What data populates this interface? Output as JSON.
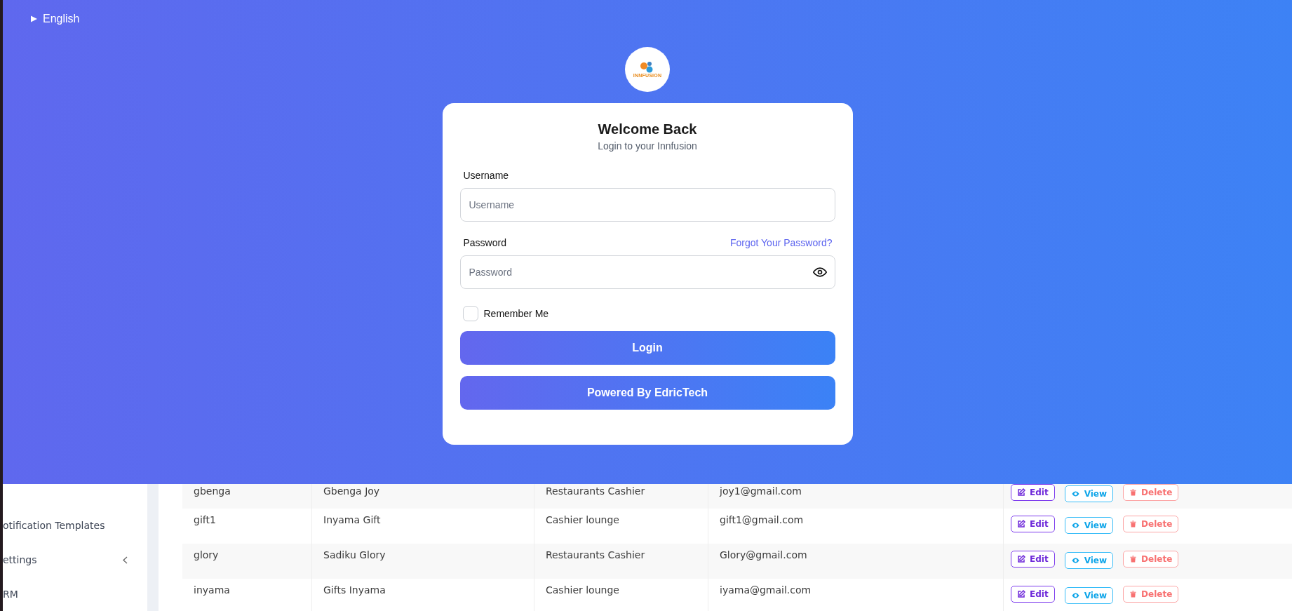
{
  "language": {
    "label": "English",
    "expanded": false
  },
  "logo": {
    "text": "INNFUSION"
  },
  "login": {
    "title": "Welcome Back",
    "subtitle": "Login to your Innfusion",
    "username": {
      "label": "Username",
      "placeholder": "Username"
    },
    "password": {
      "label": "Password",
      "placeholder": "Password",
      "forgot_link": "Forgot Your Password?"
    },
    "remember_me": {
      "label": "Remember Me",
      "checked": false
    },
    "buttons": [
      "Login",
      "Powered By EdricTech"
    ]
  },
  "sidebar": {
    "items": [
      {
        "label": "otification Templates",
        "expandable": false
      },
      {
        "label": "ettings",
        "expandable": true
      },
      {
        "label": "RM",
        "expandable": false
      }
    ]
  },
  "table": {
    "rows": [
      {
        "cells": [
          "gbenga",
          "Gbenga Joy",
          "Restaurants Cashier",
          "joy1@gmail.com"
        ],
        "actions": [
          "Edit",
          "View",
          "Delete"
        ]
      },
      {
        "cells": [
          "gift1",
          "Inyama Gift",
          "Cashier lounge",
          "gift1@gmail.com"
        ],
        "actions": [
          "Edit",
          "View",
          "Delete"
        ]
      },
      {
        "cells": [
          "glory",
          "Sadiku Glory",
          "Restaurants Cashier",
          "Glory@gmail.com"
        ],
        "actions": [
          "Edit",
          "View",
          "Delete"
        ]
      },
      {
        "cells": [
          "inyama",
          "Gifts Inyama",
          "Cashier lounge",
          "iyama@gmail.com"
        ],
        "actions": [
          "Edit",
          "View",
          "Delete"
        ]
      }
    ]
  }
}
